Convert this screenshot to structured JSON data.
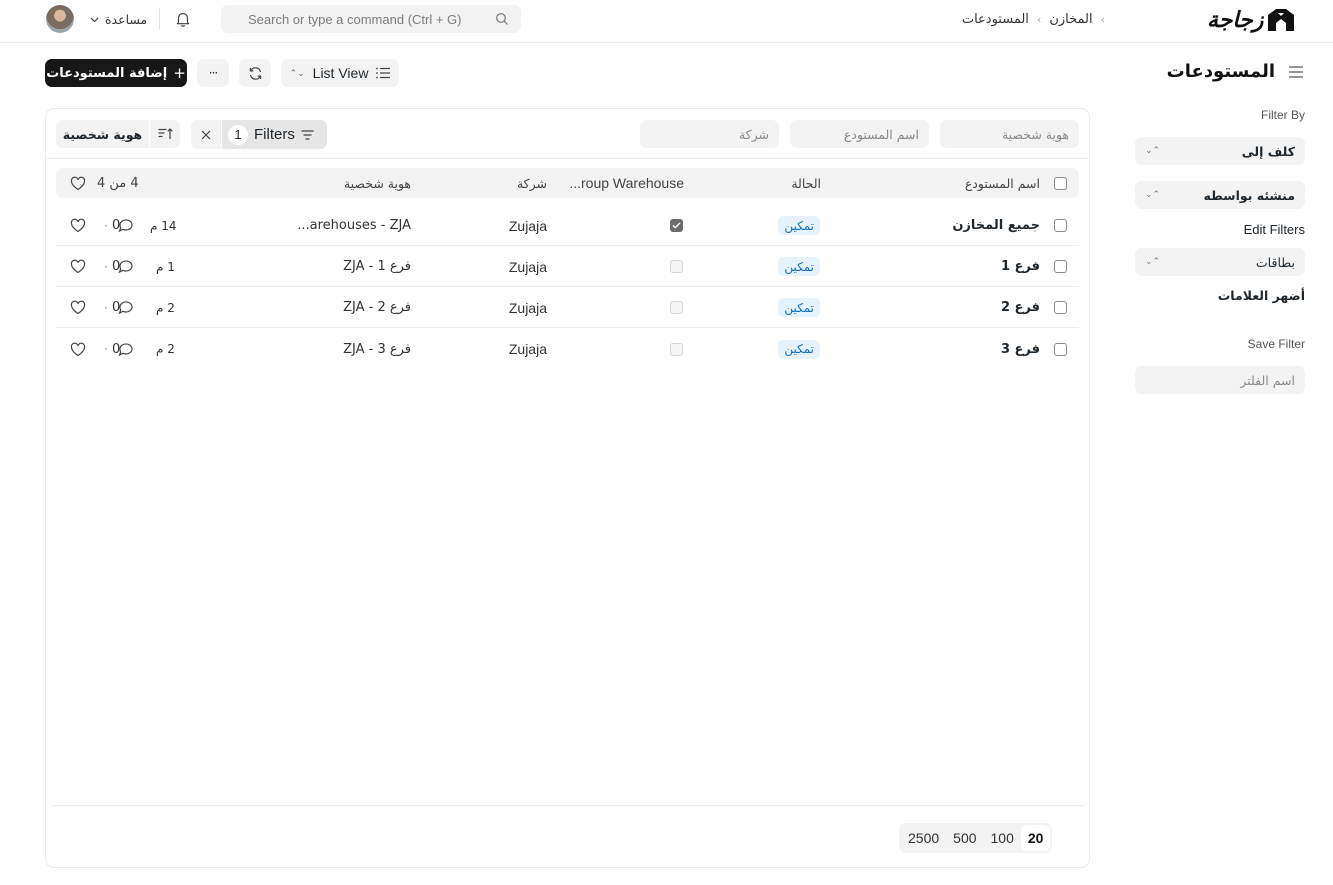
{
  "navbar": {
    "help_label": "مساعدة",
    "search_placeholder": "Search or type a command (Ctrl + G)",
    "breadcrumb": [
      "المخازن",
      "المستودعات"
    ],
    "logo_text": "زجاجة"
  },
  "page": {
    "title": "المستودعات",
    "add_button": "إضافة المستودعات",
    "more_label": "···",
    "list_view_label": "List View"
  },
  "sidebar": {
    "filter_by": "Filter By",
    "assigned_to": "كلف إلى",
    "created_by": "منشئه بواسطه",
    "edit_filters": "Edit Filters",
    "tags": "بطاقات",
    "show_tags": "أضهر العلامات",
    "save_filter": "Save Filter",
    "filter_name_placeholder": "اسم الفلتر"
  },
  "filter_bar": {
    "id_placeholder": "هوية شخصية",
    "warehouse_name_placeholder": "اسم المستودع",
    "company_placeholder": "شركة",
    "filters_label": "Filters",
    "filters_count": "1",
    "sort_label": "هوية شخصية"
  },
  "table": {
    "headers": {
      "name": "اسم المستودع",
      "status": "الحالة",
      "is_group": "...roup Warehouse",
      "company": "شركة",
      "id": "هوية شخصية",
      "count": "4 من 4"
    },
    "rows": [
      {
        "name": "جميع المخازن",
        "status": "تمكين",
        "is_group": true,
        "company": "Zujaja",
        "id": "...arehouses - ZJA",
        "modified": "14 م",
        "comments": "0"
      },
      {
        "name": "فرع 1",
        "status": "تمكين",
        "is_group": false,
        "company": "Zujaja",
        "id": "فرع 1 - ZJA",
        "modified": "1 م",
        "comments": "0"
      },
      {
        "name": "فرع 2",
        "status": "تمكين",
        "is_group": false,
        "company": "Zujaja",
        "id": "فرع 2 - ZJA",
        "modified": "2 م",
        "comments": "0"
      },
      {
        "name": "فرع 3",
        "status": "تمكين",
        "is_group": false,
        "company": "Zujaja",
        "id": "فرع 3 - ZJA",
        "modified": "2 م",
        "comments": "0"
      }
    ]
  },
  "pagination": {
    "options": [
      "20",
      "100",
      "500",
      "2500"
    ],
    "selected": "20"
  }
}
